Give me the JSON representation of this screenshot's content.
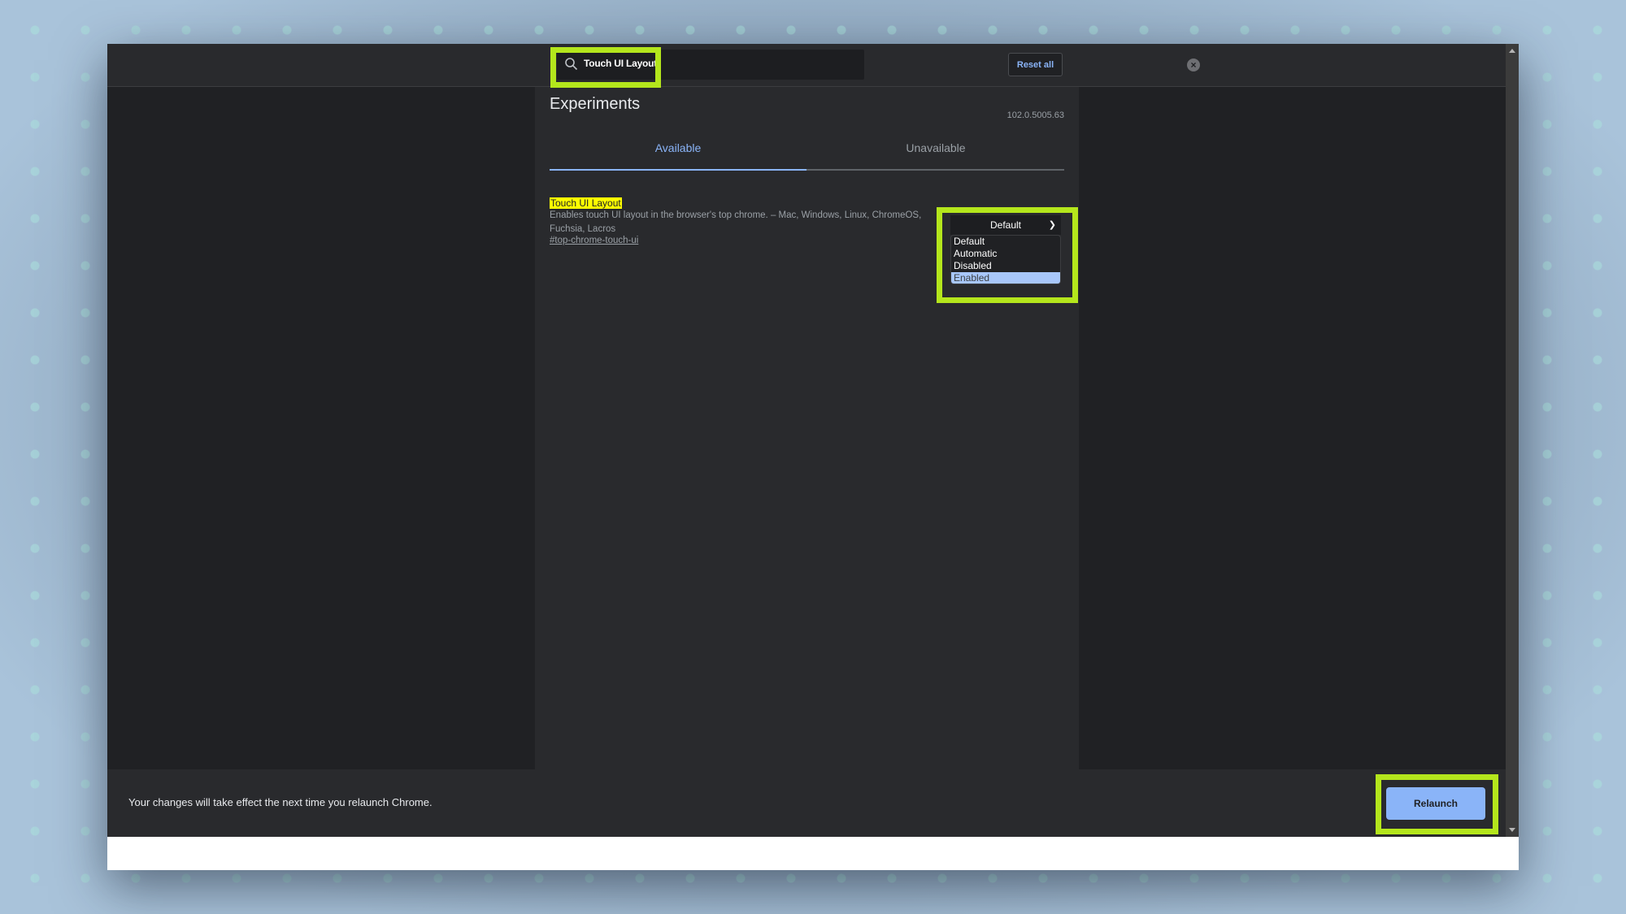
{
  "search": {
    "value": "Touch UI Layout",
    "clear_icon": "clear-circle-icon"
  },
  "header": {
    "reset_label": "Reset all"
  },
  "page": {
    "title": "Experiments",
    "version": "102.0.5005.63",
    "tabs": [
      {
        "label": "Available",
        "active": true
      },
      {
        "label": "Unavailable",
        "active": false
      }
    ]
  },
  "flag": {
    "name": "Touch UI Layout",
    "description": "Enables touch UI layout in the browser's top chrome. – Mac, Windows, Linux, ChromeOS, Fuchsia, Lacros",
    "link": "#top-chrome-touch-ui",
    "select": {
      "value": "Default",
      "options": [
        "Default",
        "Automatic",
        "Disabled",
        "Enabled"
      ],
      "highlighted": "Enabled"
    }
  },
  "notification": {
    "message": "Your changes will take effect the next time you relaunch Chrome.",
    "relaunch_label": "Relaunch"
  },
  "colors": {
    "accent": "#8ab4f8",
    "highlight_frame": "#b4e61c",
    "search_match": "#ffff00"
  }
}
